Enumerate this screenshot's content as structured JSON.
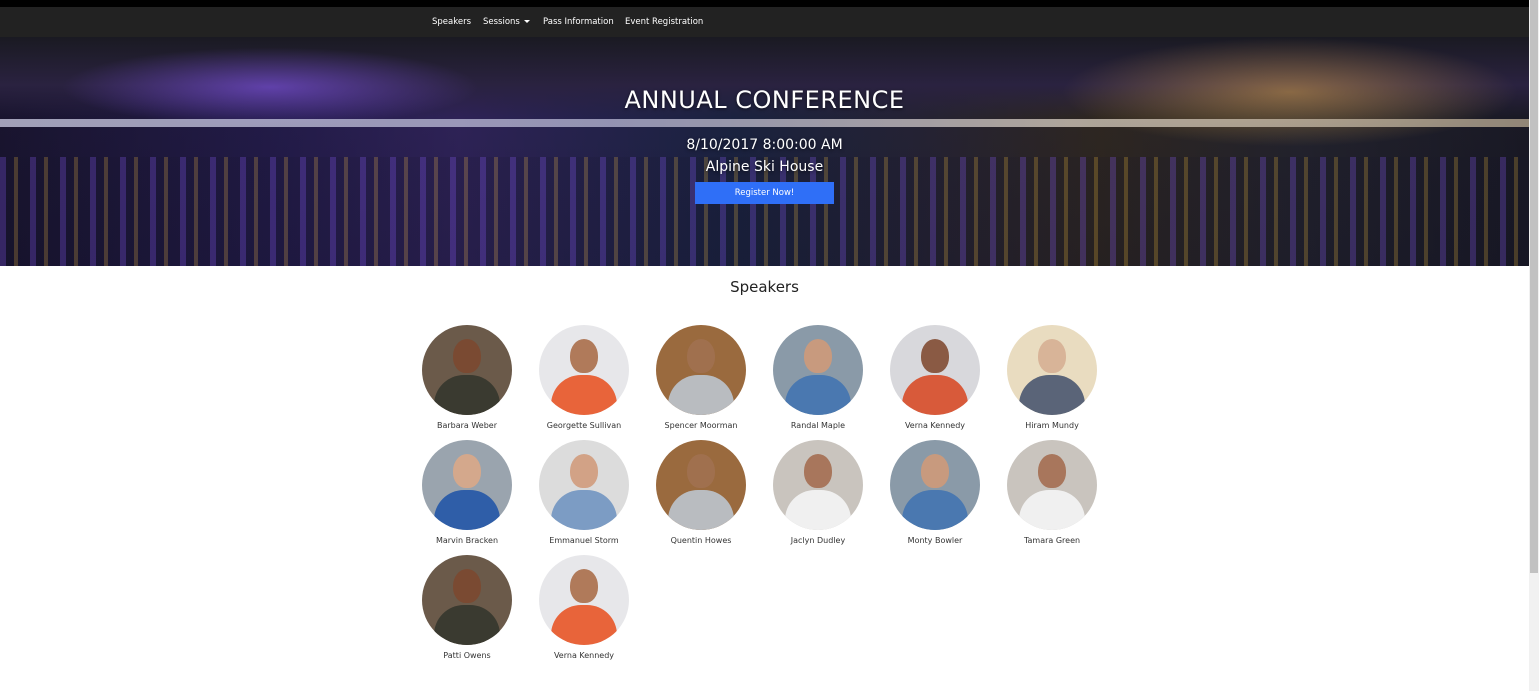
{
  "nav": {
    "items": [
      {
        "label": "Speakers"
      },
      {
        "label": "Sessions"
      },
      {
        "label": "Pass Information"
      },
      {
        "label": "Event Registration"
      }
    ]
  },
  "hero": {
    "title": "ANNUAL CONFERENCE",
    "date": "8/10/2017 8:00:00 AM",
    "venue": "Alpine Ski House",
    "register_label": "Register Now!"
  },
  "speakers_section": {
    "title": "Speakers",
    "speakers": [
      {
        "name": "Barbara Weber"
      },
      {
        "name": "Georgette Sullivan"
      },
      {
        "name": "Spencer Moorman"
      },
      {
        "name": "Randal Maple"
      },
      {
        "name": "Verna Kennedy"
      },
      {
        "name": "Hiram Mundy"
      },
      {
        "name": "Marvin Bracken"
      },
      {
        "name": "Emmanuel Storm"
      },
      {
        "name": "Quentin Howes"
      },
      {
        "name": "Jaclyn Dudley"
      },
      {
        "name": "Monty Bowler"
      },
      {
        "name": "Tamara Green"
      },
      {
        "name": "Patti Owens"
      },
      {
        "name": "Verna Kennedy"
      }
    ]
  },
  "colors": {
    "navbar": "#222222",
    "accent": "#2f6ff7"
  }
}
